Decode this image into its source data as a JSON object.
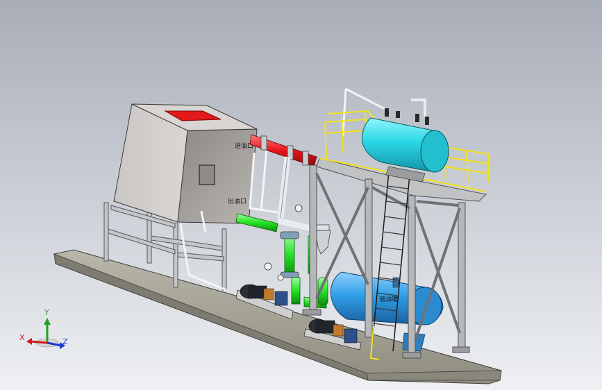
{
  "scene": {
    "colors": {
      "background_top": "#a8adb8",
      "background_bottom": "#eef0f3",
      "steel": "#b5b7b9",
      "steel_dark": "#6f7275",
      "tank_cyan": "#29d6e6",
      "tank_blue": "#2f9ee8",
      "pipe_red": "#e8141a",
      "pipe_green": "#22e222",
      "rail_yellow": "#f2e21a",
      "base_plate": "#a9a799"
    },
    "box_labels": {
      "upper": "进油口",
      "lower": "出油口"
    },
    "tank_label": "储油罐"
  },
  "triad": {
    "x": "X",
    "y": "Y",
    "z": "Z"
  }
}
